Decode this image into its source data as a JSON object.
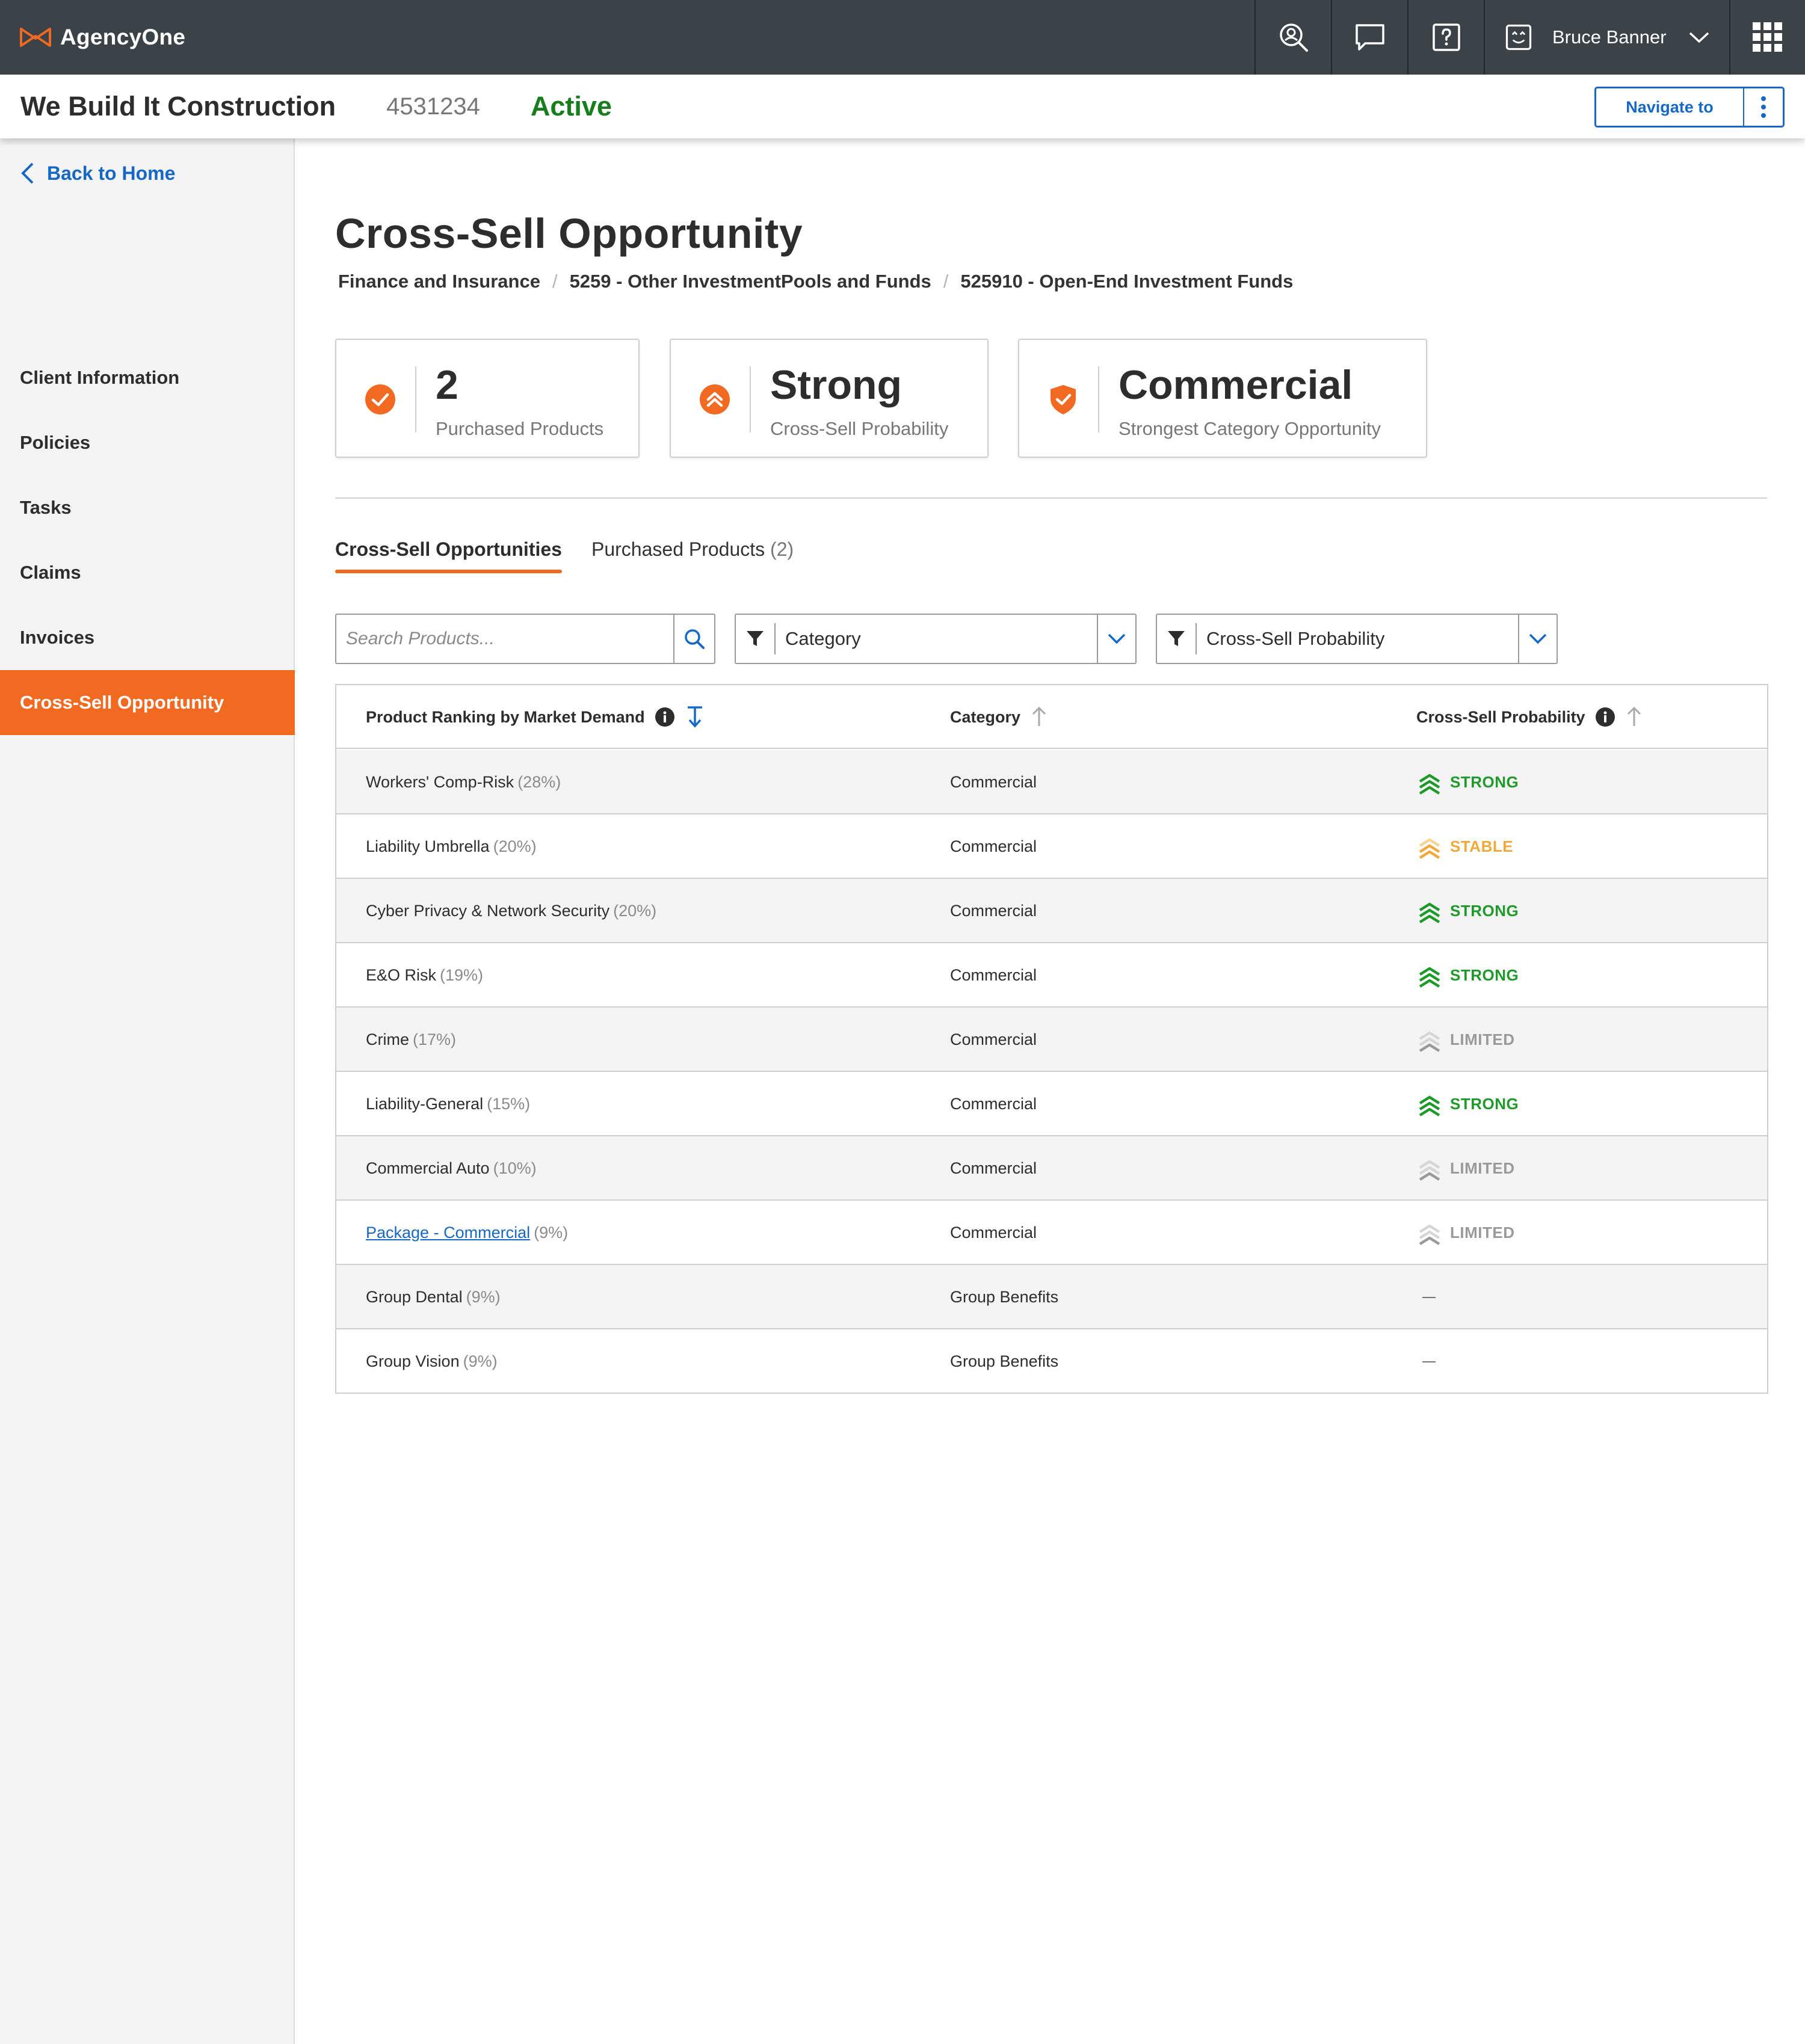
{
  "app": {
    "brand": "AgencyOne",
    "user_name": "Bruce Banner",
    "icons": [
      "search-person-icon",
      "chat-icon",
      "help-icon",
      "user-face-icon",
      "chevron-down-icon",
      "apps-grid-icon"
    ]
  },
  "client": {
    "name": "We Build It Construction",
    "id": "4531234",
    "status": "Active",
    "navigate_label": "Navigate to"
  },
  "sidebar": {
    "back_label": "Back to Home",
    "items": [
      {
        "label": "Client Information"
      },
      {
        "label": "Policies"
      },
      {
        "label": "Tasks"
      },
      {
        "label": "Claims"
      },
      {
        "label": "Invoices"
      },
      {
        "label": "Cross-Sell Opportunity"
      }
    ]
  },
  "page": {
    "title": "Cross-Sell Opportunity",
    "breadcrumb": [
      "Finance and Insurance",
      "5259 - Other InvestmentPools and Funds",
      "525910 -  Open-End Investment Funds"
    ]
  },
  "summary": [
    {
      "value": "2",
      "label": "Purchased Products",
      "icon": "check-circle-icon"
    },
    {
      "value": "Strong",
      "label": "Cross-Sell Probability",
      "icon": "double-chevron-up-icon"
    },
    {
      "value": "Commercial",
      "label": "Strongest Category Opportunity",
      "icon": "shield-check-icon"
    }
  ],
  "tabs": [
    {
      "label": "Cross-Sell Opportunities",
      "count": ""
    },
    {
      "label": "Purchased Products",
      "count": "(2)"
    }
  ],
  "filters": {
    "search_placeholder": "Search Products...",
    "category_label": "Category",
    "probability_label": "Cross-Sell Probability"
  },
  "table": {
    "headers": {
      "product": "Product Ranking by Market Demand",
      "category": "Category",
      "probability": "Cross-Sell Probability"
    },
    "rows": [
      {
        "product": "Workers' Comp-Risk",
        "pct": "(28%)",
        "category": "Commercial",
        "probability": "STRONG",
        "link": false
      },
      {
        "product": "Liability Umbrella",
        "pct": "(20%)",
        "category": "Commercial",
        "probability": "STABLE",
        "link": false
      },
      {
        "product": "Cyber Privacy & Network Security",
        "pct": "(20%)",
        "category": "Commercial",
        "probability": "STRONG",
        "link": false
      },
      {
        "product": "E&O Risk",
        "pct": "(19%)",
        "category": "Commercial",
        "probability": "STRONG",
        "link": false
      },
      {
        "product": "Crime",
        "pct": "(17%)",
        "category": "Commercial",
        "probability": "LIMITED",
        "link": false
      },
      {
        "product": "Liability-General",
        "pct": "(15%)",
        "category": "Commercial",
        "probability": "STRONG",
        "link": false
      },
      {
        "product": "Commercial Auto",
        "pct": "(10%)",
        "category": "Commercial",
        "probability": "LIMITED",
        "link": false
      },
      {
        "product": "Package - Commercial",
        "pct": "(9%)",
        "category": "Commercial",
        "probability": "LIMITED",
        "link": true
      },
      {
        "product": "Group Dental",
        "pct": "(9%)",
        "category": "Group Benefits",
        "probability": "",
        "link": false
      },
      {
        "product": "Group Vision",
        "pct": "(9%)",
        "category": "Group Benefits",
        "probability": "",
        "link": false
      }
    ]
  },
  "colors": {
    "accent": "#f26a21",
    "link": "#1668c7",
    "active_status": "#177d1e",
    "strong": "#1f9a2a",
    "stable": "#f0a93b",
    "limited": "#9a9a9a",
    "topbar": "#3b4348"
  }
}
